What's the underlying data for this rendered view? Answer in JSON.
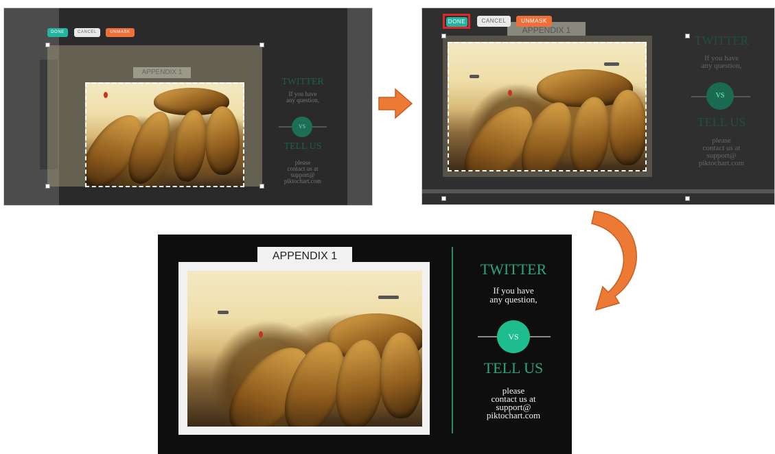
{
  "toolbar": {
    "done_label": "DONE",
    "cancel_label": "CANCEL",
    "unmask_label": "UNMASK"
  },
  "infographic": {
    "appendix_label": "APPENDIX 1",
    "twitter_heading": "TWITTER",
    "twitter_text_line1": "If you have",
    "twitter_text_line2": "any question,",
    "vs_label": "VS",
    "tell_us_heading": "TELL US",
    "contact_line1": "please",
    "contact_line2": "contact us at",
    "contact_line3": "support@",
    "contact_line4": "piktochart.com"
  },
  "colors": {
    "done": "#24b3a1",
    "cancel": "#e9e9e9",
    "unmask": "#ef6f3a",
    "accent_green": "#2aa57e",
    "arrow": "#ec7a34",
    "highlight": "#e0262a"
  },
  "icons": [
    "arrow-right-icon",
    "curved-arrow-icon"
  ]
}
